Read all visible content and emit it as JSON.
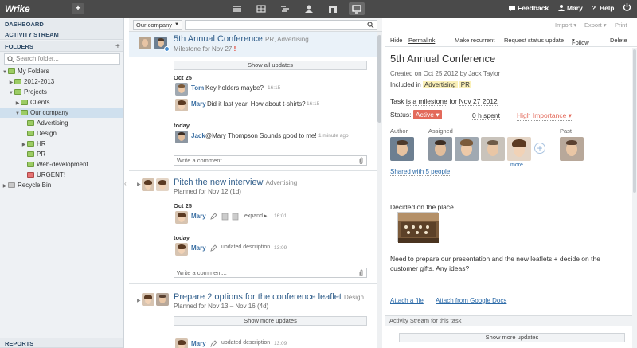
{
  "topbar": {
    "logo": "Wrike",
    "add": "+",
    "feedback": "Feedback",
    "user": "Mary",
    "help": "Help"
  },
  "sidebar": {
    "dashboard": "DASHBOARD",
    "activity": "ACTIVITY STREAM",
    "folders": "FOLDERS",
    "add": "+",
    "search_placeholder": "Search folder...",
    "tree": {
      "my_folders": "My Folders",
      "y2012": "2012-2013",
      "projects": "Projects",
      "clients": "Clients",
      "our_company": "Our company",
      "advertising": "Advertising",
      "design": "Design",
      "hr": "HR",
      "pr": "PR",
      "webdev": "Web-development",
      "urgent": "URGENT!",
      "recycle": "Recycle Bin"
    },
    "reports": "REPORTS"
  },
  "middle": {
    "company": "Our company",
    "tasks": [
      {
        "title": "5th Annual Conference",
        "tag": "PR, Advertising",
        "sub": "Milestone for Nov 27",
        "show": "Show all updates",
        "date1": "Oct 25",
        "u1_who": "Tom",
        "u1_txt": "Key holders maybe?",
        "u1_time": "16:15",
        "u2_who": "Mary",
        "u2_txt": "Did it last year. How about t-shirts?",
        "u2_time": "16:15",
        "date2": "today",
        "u3_who": "Jack",
        "u3_txt": "@Mary Thompson Sounds good to me!",
        "u3_time": "1 minute ago",
        "comment": "Write a comment..."
      },
      {
        "title": "Pitch the new interview",
        "tag": "Advertising",
        "sub": "Planned for Nov 12 (1d)",
        "date1": "Oct 25",
        "u1_who": "Mary",
        "u1_txt": "expand",
        "u1_time": "16:01",
        "date2": "today",
        "u2_who": "Mary",
        "u2_txt": "updated description",
        "u2_time": "13:09",
        "comment": "Write a comment..."
      },
      {
        "title": "Prepare 2 options for the conference leaflet",
        "tag": "Design",
        "sub": "Planned for Nov 13 – Nov 16 (4d)",
        "show": "Show more updates",
        "u1_who": "Mary",
        "u1_txt": "updated description",
        "u1_time": "13:09"
      }
    ]
  },
  "right": {
    "toolbar": {
      "hide": "Hide",
      "permalink": "Permalink",
      "recurrent": "Make recurrent",
      "request": "Request status update",
      "follow": "Follow",
      "delete": "Delete",
      "import": "Import",
      "export": "Export",
      "print": "Print"
    },
    "title": "5th Annual Conference",
    "created": "Created on Oct 25 2012 by Jack Taylor",
    "included_label": "Included in",
    "tag1": "Advertising",
    "tag2": "PR",
    "milestone_pre": "Task",
    "milestone_is": "is a milestone",
    "milestone_for": "for",
    "milestone_date": "Nov 27 2012",
    "status_label": "Status:",
    "status": "Active",
    "spent": "0 h spent",
    "importance": "High Importance",
    "author": "Author",
    "assigned": "Assigned",
    "past": "Past",
    "more": "more...",
    "shared": "Shared with 5 people",
    "decided": "Decided on the place.",
    "desc": "Need to prepare our presentation and the new leaflets + decide on the customer gifts. Any ideas?",
    "attach": "Attach a file",
    "attach_gdocs": "Attach from Google Docs",
    "stream": "Activity Stream for this task",
    "show_more": "Show more updates"
  },
  "colors": {
    "topbar": "#4a4a4a",
    "link": "#2b6aa8",
    "status": "#e36a5b",
    "tag": "#fbf1b8",
    "folder_green": "#9ccc65"
  }
}
